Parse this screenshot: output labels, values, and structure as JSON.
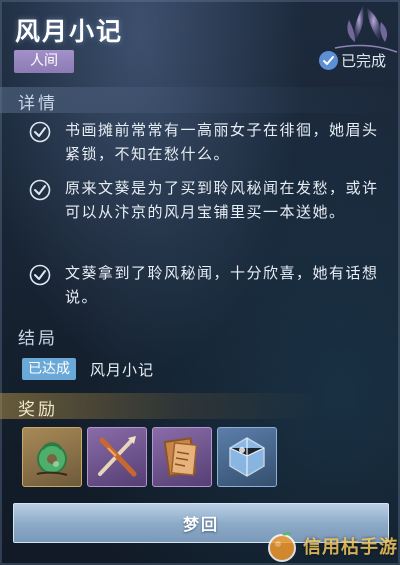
{
  "quest": {
    "title": "风月小记",
    "realm_tag": "人间",
    "status_label": "已完成",
    "status_icon": "check-circle-icon",
    "emblem_icon": "lotus-emblem-icon"
  },
  "details": {
    "header": "详情",
    "items": [
      {
        "text": "书画摊前常常有一高丽女子在徘徊，她眉头紧锁，不知在愁什么。",
        "icon": "check-icon"
      },
      {
        "text": "原来文葵是为了买到聆风秘闻在发愁，或许可以从汴京的风月宝铺里买一本送她。",
        "icon": "check-icon"
      },
      {
        "text": "文葵拿到了聆风秘闻，十分欣喜，她有话想说。",
        "icon": "check-icon"
      }
    ]
  },
  "ending": {
    "header": "结局",
    "badge": "已达成",
    "name": "风月小记"
  },
  "rewards": {
    "header": "奖励",
    "items": [
      {
        "icon": "jade-pendant-icon",
        "color": "#4fae6a"
      },
      {
        "icon": "crossed-weapons-icon",
        "color": "#c8682e"
      },
      {
        "icon": "book-scroll-icon",
        "color": "#c9854a"
      },
      {
        "icon": "crystal-cube-icon",
        "color": "#9fd0ff"
      }
    ]
  },
  "action": {
    "dream_button_label": "梦回"
  },
  "watermark": {
    "text": "信用枯手游",
    "icon": "orange-logo-icon"
  }
}
